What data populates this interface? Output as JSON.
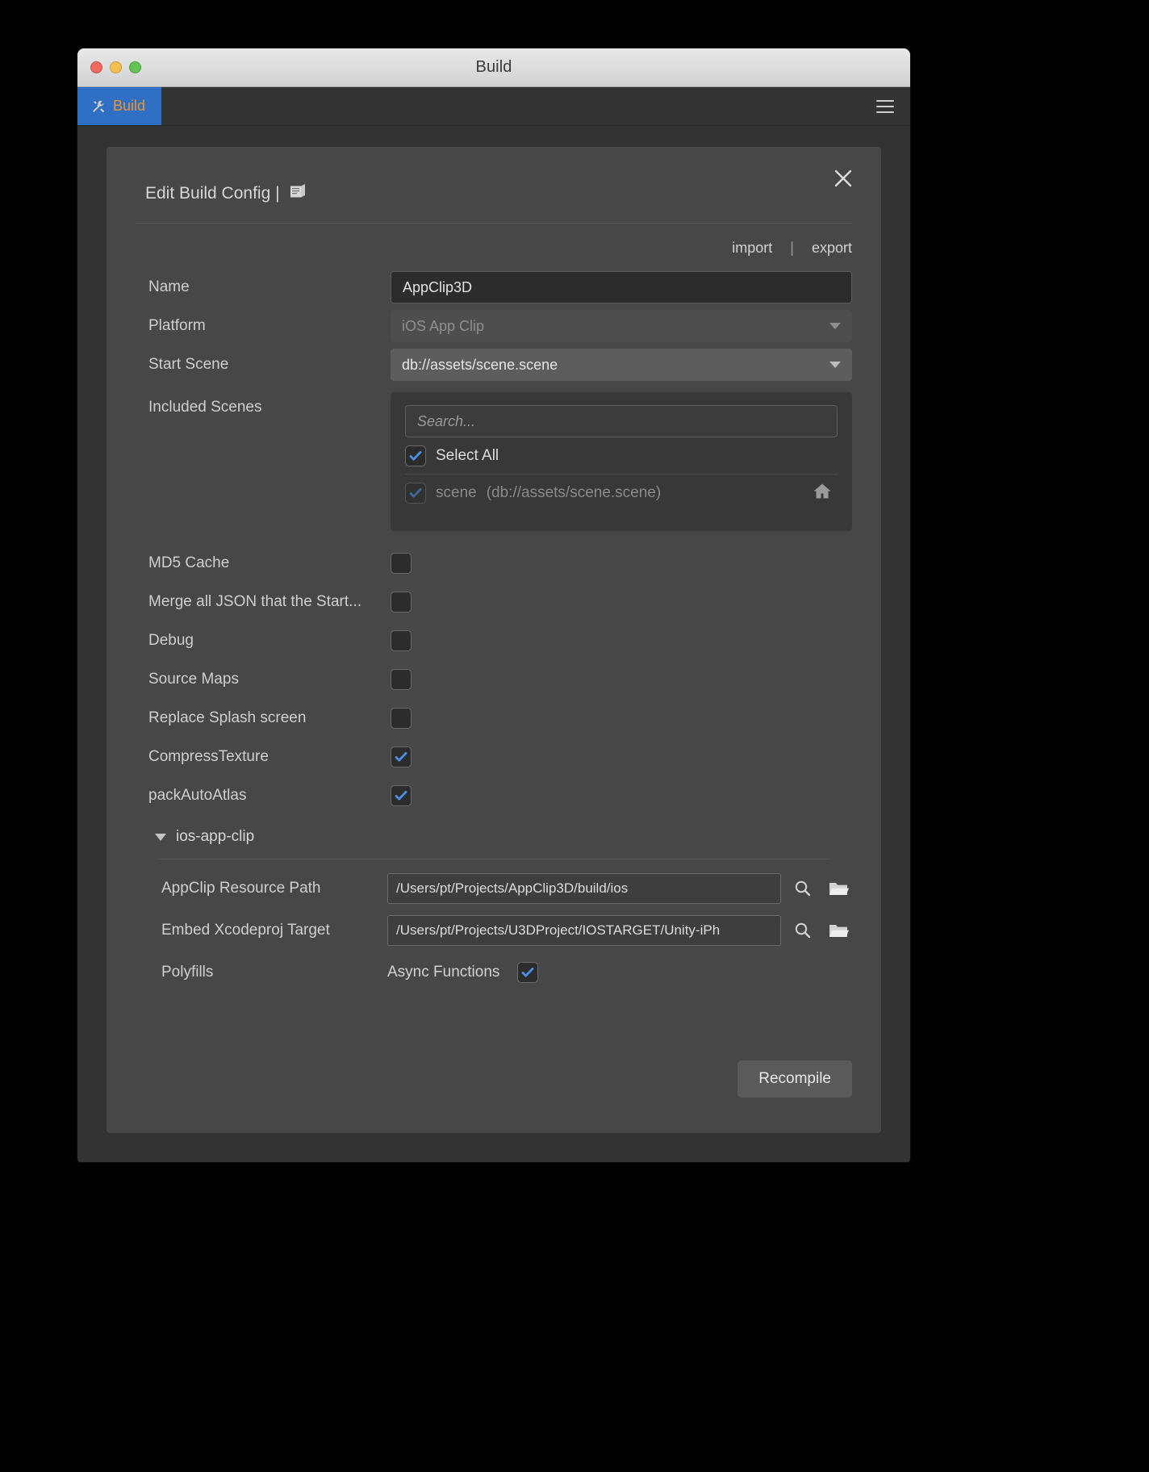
{
  "window": {
    "title": "Build",
    "traffic_lights": [
      "close",
      "minimize",
      "zoom"
    ]
  },
  "tab": {
    "label": "Build",
    "icon": "hammer-wrench-icon",
    "accent_bg": "#2f6fc4",
    "accent_text": "#f0942c"
  },
  "menu": {
    "icon": "hamburger-menu-icon"
  },
  "dialog": {
    "title": "Edit Build Config |",
    "title_icon": "book-icon",
    "close_icon": "close-icon",
    "import_label": "import",
    "separator": "|",
    "export_label": "export"
  },
  "fields": {
    "name": {
      "label": "Name",
      "value": "AppClip3D"
    },
    "platform": {
      "label": "Platform",
      "value": "iOS App Clip",
      "disabled": true
    },
    "start_scene": {
      "label": "Start Scene",
      "value": "db://assets/scene.scene"
    },
    "included_scenes": {
      "label": "Included Scenes",
      "search_placeholder": "Search...",
      "search_value": "",
      "select_all": {
        "label": "Select All",
        "checked": true
      },
      "items": [
        {
          "name": "scene",
          "path": "(db://assets/scene.scene)",
          "checked": true,
          "dimmed": true,
          "trailing_icon": "home-icon"
        }
      ]
    }
  },
  "options": [
    {
      "label": "MD5 Cache",
      "checked": false
    },
    {
      "label": "Merge all JSON that the Start...",
      "checked": false
    },
    {
      "label": "Debug",
      "checked": false
    },
    {
      "label": "Source Maps",
      "checked": false
    },
    {
      "label": "Replace Splash screen",
      "checked": false
    },
    {
      "label": "CompressTexture",
      "checked": true
    },
    {
      "label": "packAutoAtlas",
      "checked": true
    }
  ],
  "section": {
    "title": "ios-app-clip",
    "expanded": true,
    "rows": [
      {
        "label": "AppClip Resource Path",
        "value": "/Users/pt/Projects/AppClip3D/build/ios",
        "icons": [
          "magnifier-icon",
          "folder-icon"
        ]
      },
      {
        "label": "Embed Xcodeproj Target",
        "value": "/Users/pt/Projects/U3DProject/IOSTARGET/Unity-iPh",
        "icons": [
          "magnifier-icon",
          "folder-icon"
        ]
      }
    ],
    "polyfills": {
      "label": "Polyfills",
      "option_label": "Async Functions",
      "checked": true
    }
  },
  "footer": {
    "recompile_label": "Recompile"
  },
  "colors": {
    "accent_blue": "#4a90e2",
    "tab_blue": "#2f6fc4",
    "tab_orange": "#f0942c",
    "panel_bg": "#474747",
    "window_bg": "#333333"
  }
}
